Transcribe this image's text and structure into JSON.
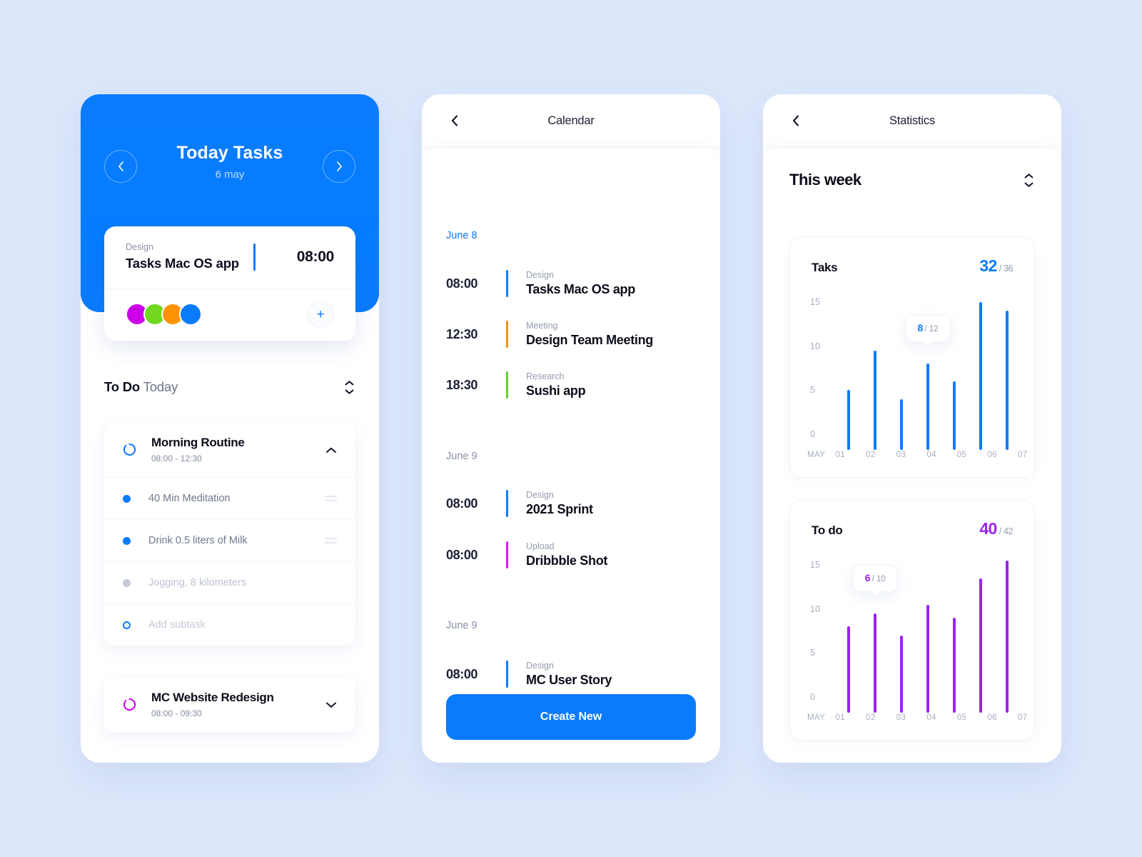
{
  "background_color": "#dce7fb",
  "accent_blue": "#0b7bfd",
  "accent_purple": "#9b23f0",
  "panel_today": {
    "hero": {
      "title": "Today Tasks",
      "date": "6 may",
      "prev_label": "‹",
      "next_label": "›"
    },
    "feature": {
      "category": "Design",
      "title": "Tasks Mac OS app",
      "time": "08:00",
      "add_label": "+",
      "swatches": [
        "#cb00e8",
        "#6fd81f",
        "#ff9300",
        "#0b7bfd"
      ]
    },
    "todo_header": {
      "bold": "To Do",
      "normal": "Today"
    },
    "tasks": [
      {
        "name": "Morning Routine",
        "range": "08:00 - 12:30",
        "ring_color": "#0b7bfd",
        "expanded": true,
        "subtasks": [
          {
            "label": "40 Min Meditation",
            "state": "open",
            "handle": true
          },
          {
            "label": "Drink 0.5 liters of Milk",
            "state": "open",
            "handle": true
          },
          {
            "label": "Jogging, 8 kilometers",
            "state": "done",
            "handle": false
          },
          {
            "label": "Add  subtask",
            "state": "add",
            "handle": false
          }
        ]
      },
      {
        "name": "MC Website Redesign",
        "range": "08:00 - 09:30",
        "ring_color": "#cb00e8",
        "expanded": false,
        "subtasks": []
      }
    ]
  },
  "panel_calendar": {
    "title": "Calendar",
    "back_label": "‹",
    "groups": [
      {
        "day": "June 8",
        "active": true,
        "events": [
          {
            "time": "08:00",
            "category": "Design",
            "title": "Tasks Mac OS app",
            "color": "#0b7bfd"
          },
          {
            "time": "12:30",
            "category": "Meeting",
            "title": "Design Team Meeting",
            "color": "#f79009"
          },
          {
            "time": "18:30",
            "category": "Research",
            "title": "Sushi app",
            "color": "#62d227"
          }
        ]
      },
      {
        "day": "June 9",
        "active": false,
        "events": [
          {
            "time": "08:00",
            "category": "Design",
            "title": "2021 Sprint",
            "color": "#0b7bfd"
          },
          {
            "time": "08:00",
            "category": "Upload",
            "title": "Dribbble Shot",
            "color": "#d916e8"
          }
        ]
      },
      {
        "day": "June 9",
        "active": false,
        "events": [
          {
            "time": "08:00",
            "category": "Design",
            "title": "MC User Story",
            "color": "#0b7bfd"
          }
        ]
      }
    ],
    "create_button": "Create New"
  },
  "panel_statistics": {
    "title": "Statistics",
    "back_label": "‹",
    "week_label": "This week"
  },
  "chart_data": [
    {
      "type": "bar",
      "title": "Taks",
      "value": "32",
      "total": "/ 36",
      "color": "#0b7bfd",
      "xlabel": "MAY",
      "categories": [
        "01",
        "02",
        "03",
        "04",
        "05",
        "06",
        "07"
      ],
      "values": [
        5,
        9.5,
        4,
        8,
        6,
        15,
        14
      ],
      "ylim": [
        0,
        15
      ],
      "yticks": [
        15,
        10,
        5,
        0
      ],
      "grid": false,
      "tooltip": {
        "index": 3,
        "value": "8",
        "total": "/ 12"
      }
    },
    {
      "type": "bar",
      "title": "To do",
      "value": "40",
      "total": "/ 42",
      "color": "#9b23f0",
      "xlabel": "MAY",
      "categories": [
        "01",
        "02",
        "03",
        "04",
        "05",
        "06",
        "07"
      ],
      "values": [
        8,
        9.5,
        7,
        10.5,
        9,
        13.5,
        15.5
      ],
      "ylim": [
        0,
        15
      ],
      "yticks": [
        15,
        10,
        5,
        0
      ],
      "grid": false,
      "tooltip": {
        "index": 1,
        "value": "6",
        "total": "/ 10"
      }
    }
  ]
}
